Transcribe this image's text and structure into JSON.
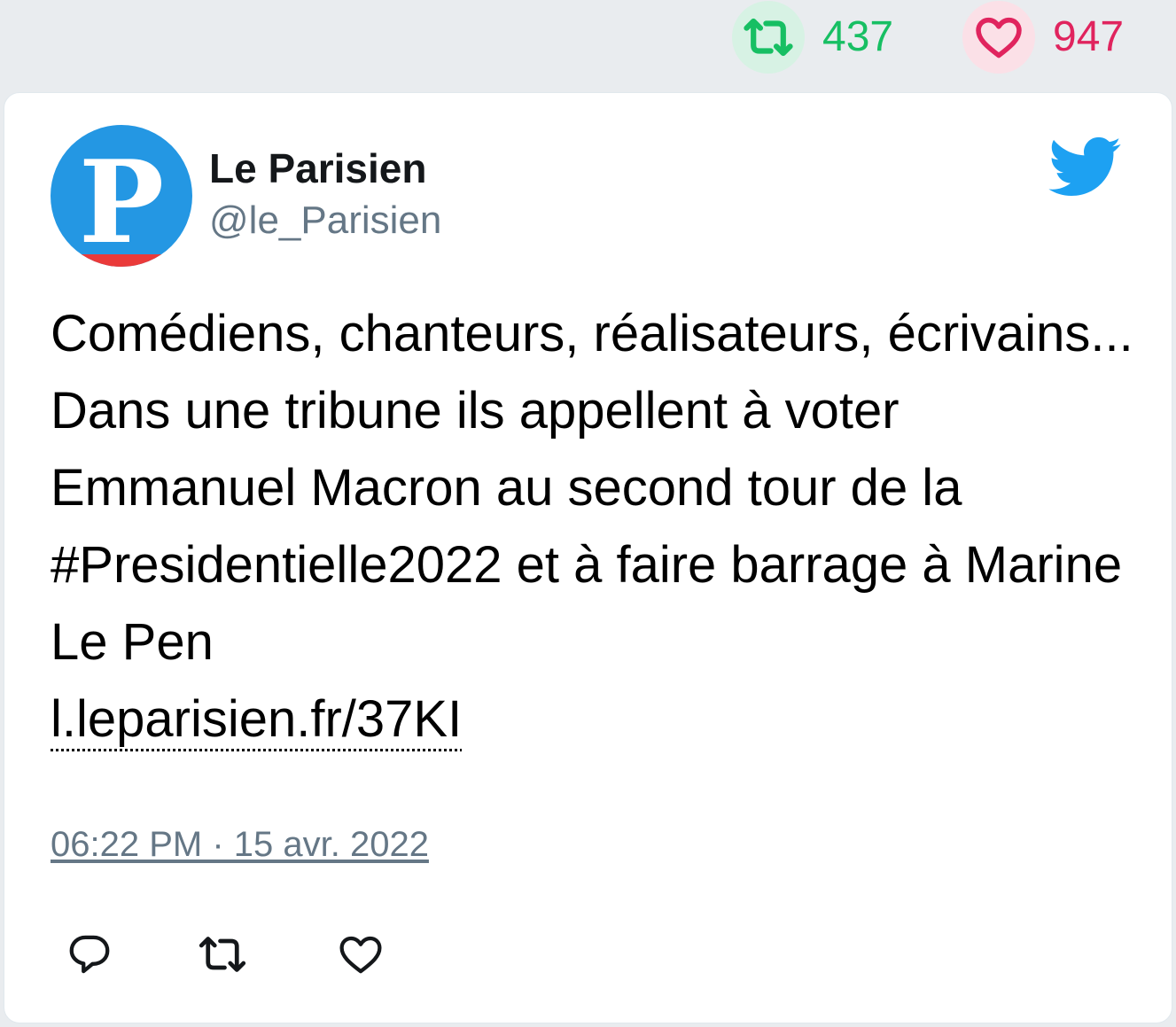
{
  "header_stats": {
    "retweets": "437",
    "likes": "947"
  },
  "author": {
    "avatar_letter": "P",
    "name": "Le Parisien",
    "handle": "@le_Parisien"
  },
  "tweet": {
    "text": "Comédiens, chanteurs, réalisateurs, écrivains... Dans une tribune ils appellent à voter Emmanuel Macron au second tour de la #Presidentielle2022 et à faire barrage à Marine Le Pen",
    "link": "l.leparisien.fr/37KI",
    "timestamp": "06:22 PM · 15 avr. 2022"
  },
  "colors": {
    "retweet": "#17bf63",
    "like": "#e0245e",
    "twitter_blue": "#1da1f2",
    "avatar_blue": "#2497e3",
    "avatar_red": "#ea3a3a"
  },
  "icons": {
    "stat_retweet": "retweet-icon",
    "stat_like": "heart-icon",
    "brand": "twitter-bird-icon",
    "reply": "reply-icon",
    "retweet": "retweet-icon",
    "like": "heart-icon"
  }
}
